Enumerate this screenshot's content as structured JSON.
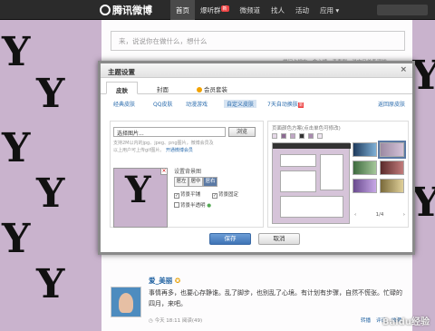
{
  "header": {
    "logo_text": "腾讯微博",
    "nav": [
      "首页",
      "爆听群",
      "微频道",
      "找人",
      "活动",
      "应用"
    ],
    "badge": "新"
  },
  "composer": {
    "placeholder": "来，说说你在做什么，想什么"
  },
  "side_hint": "提问卡学车 · 命心境 · 青春剧 · 说中日关系现状",
  "dialog": {
    "title": "主题设置",
    "close": "×",
    "tabs": [
      "皮肤",
      "封面",
      "会员套装"
    ],
    "subnav": [
      "经典皮肤",
      "QQ皮肤",
      "动漫游戏",
      "自定义皮肤",
      "7天自动换肤"
    ],
    "subnav_badge": "新",
    "restore": "返回原皮肤",
    "file_placeholder": "选择图片...",
    "browse": "浏览",
    "note_line1": "支持2M以内的jpg、jpeg、png图片，微博会员及",
    "note_line2": "以上用户可上传gif图片。",
    "note_link": "开通微博会员",
    "set_bg": "设置背景图",
    "align": [
      "居左",
      "居中",
      "居右"
    ],
    "checks": [
      "背景平铺",
      "背景固定",
      "背景半透明"
    ],
    "color_title": "页面颜色方案(点击单色可修改)",
    "pager": "1/4",
    "save": "保存",
    "cancel": "取消"
  },
  "post": {
    "author": "爱_美丽",
    "text": "事情再多，也要心存静谁。乱了脚步，也别乱了心境。有计划有步骤，自然不慌张。忙碌的四月，来吧。",
    "meta": "今天 18:11 阅读(49)",
    "actions": [
      "转播",
      "评论",
      "收藏"
    ]
  },
  "watermark": "Baidu经验",
  "colors": {
    "background": "#c9b3cd",
    "topbar": "#2b2b2b",
    "accent": "#2b6cad",
    "save_button": "#3f74b5"
  }
}
